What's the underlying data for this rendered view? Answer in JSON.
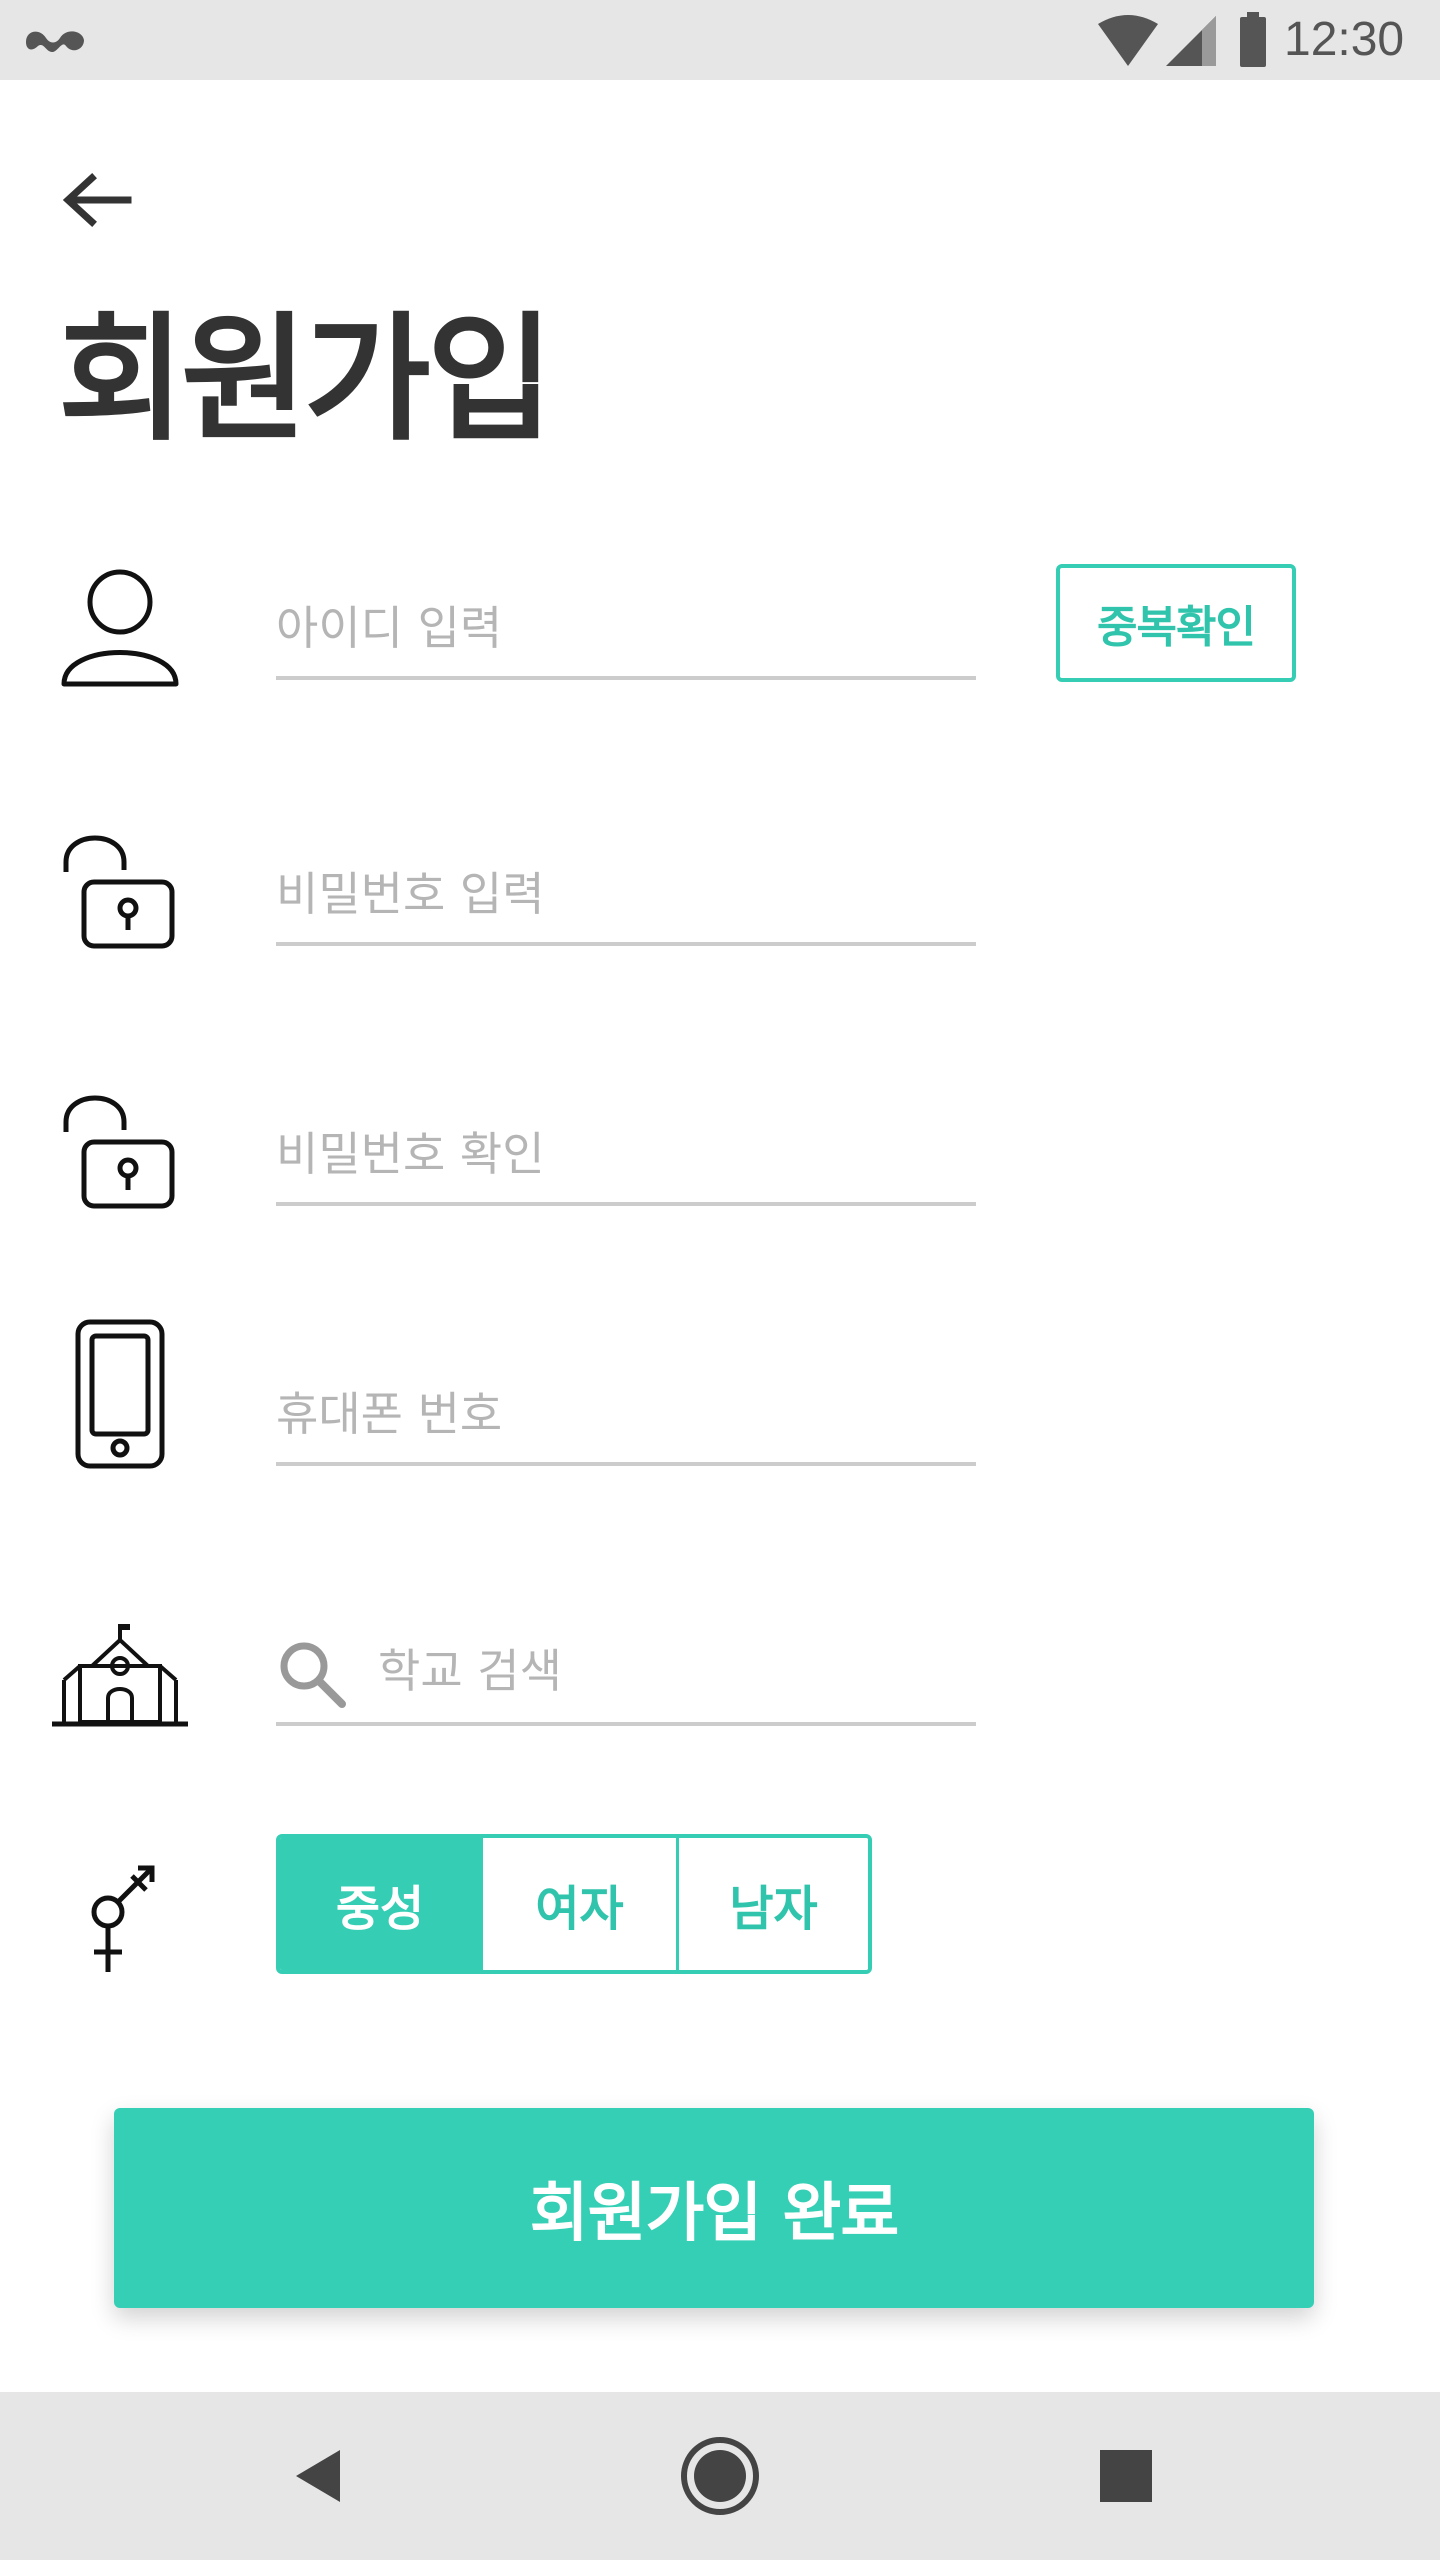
{
  "status_bar": {
    "time": "12:30",
    "icons": [
      "notification-icon",
      "wifi-icon",
      "cell-signal-icon",
      "battery-icon"
    ]
  },
  "header": {
    "back_icon": "arrow-left-icon",
    "title": "회원가입"
  },
  "form": {
    "user_id": {
      "icon": "user-icon",
      "value": "",
      "placeholder": "아이디 입력",
      "check_button_label": "중복확인"
    },
    "password": {
      "icon": "unlocked-padlock-icon",
      "value": "",
      "placeholder": "비밀번호 입력"
    },
    "password_confirm": {
      "icon": "unlocked-padlock-icon",
      "value": "",
      "placeholder": "비밀번호 확인"
    },
    "phone": {
      "icon": "smartphone-icon",
      "value": "",
      "placeholder": "휴대폰 번호"
    },
    "school": {
      "icon": "school-building-icon",
      "search_icon": "search-icon",
      "value": "",
      "placeholder": "학교 검색"
    },
    "gender": {
      "icon": "gender-symbol-icon",
      "options": [
        {
          "label": "중성",
          "selected": true
        },
        {
          "label": "여자",
          "selected": false
        },
        {
          "label": "남자",
          "selected": false
        }
      ]
    },
    "submit_label": "회원가입 완료"
  },
  "nav_bar": {
    "buttons": [
      "back-triangle-icon",
      "home-circle-icon",
      "recents-square-icon"
    ]
  },
  "colors": {
    "accent": "#35cdb4",
    "title_text": "#333333",
    "placeholder": "#b5b5b5",
    "underline": "#cccccc",
    "system_bar": "#e6e6e6"
  }
}
